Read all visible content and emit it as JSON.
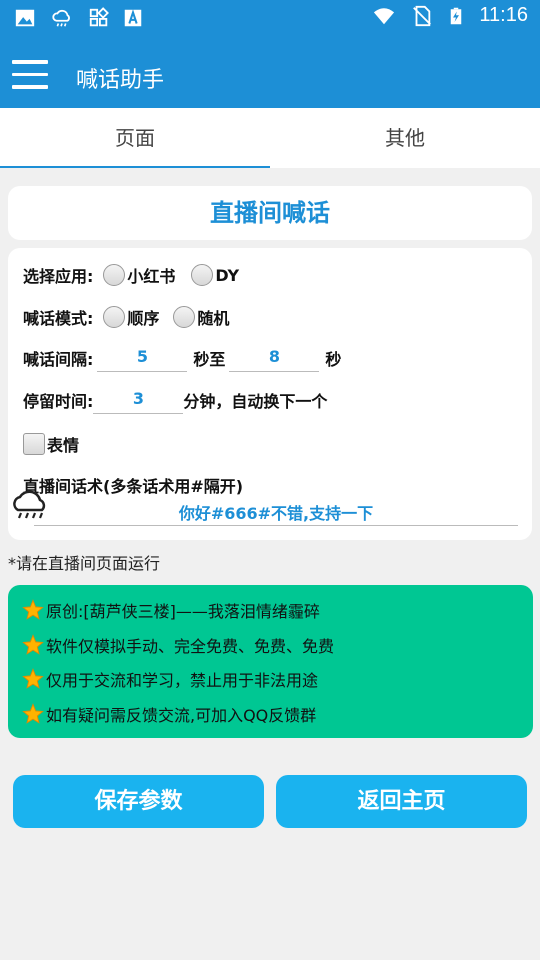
{
  "status_bar": {
    "time": "11:16",
    "icons": [
      "image-icon",
      "cloud-rain-icon",
      "grid-icon",
      "font-icon",
      "wifi-icon",
      "no-sim-icon",
      "battery-charging-icon"
    ]
  },
  "app_bar": {
    "title": "喊话助手"
  },
  "tabs": [
    {
      "label": "页面",
      "active": true
    },
    {
      "label": "其他",
      "active": false
    }
  ],
  "title_card": {
    "title": "直播间喊话"
  },
  "form": {
    "app_select": {
      "label": "选择应用:",
      "options": [
        "小红书",
        "DY"
      ]
    },
    "mode": {
      "label": "喊话模式:",
      "options": [
        "顺序",
        "随机"
      ]
    },
    "interval": {
      "label": "喊话间隔:",
      "min": "5",
      "mid_text": "秒至",
      "max": "8",
      "unit": "秒"
    },
    "stay": {
      "label": "停留时间:",
      "value": "3",
      "suffix": "分钟，自动换下一个"
    },
    "emoji": {
      "label": "表情",
      "checked": false
    },
    "script": {
      "label": "直播间话术(多条话术用#隔开)",
      "value": "你好#666#不错,支持一下"
    }
  },
  "hint": "*请在直播间页面运行",
  "notice": [
    "原创:[葫芦侠三楼]——我落泪情绪霾碎",
    "软件仅模拟手动、完全免费、免费、免费",
    "仅用于交流和学习，禁止用于非法用途",
    "如有疑问需反馈交流,可加入QQ反馈群"
  ],
  "buttons": {
    "save": "保存参数",
    "home": "返回主页"
  },
  "colors": {
    "primary": "#1d8fd6",
    "accent": "#00c793",
    "button": "#1ab3ef"
  }
}
